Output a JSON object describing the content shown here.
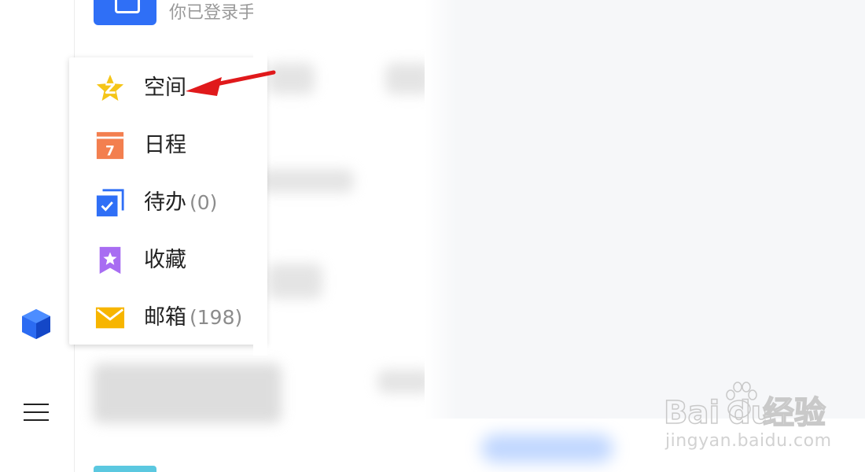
{
  "header": {
    "login_text": "你已登录手"
  },
  "menu": {
    "items": [
      {
        "label": "空间",
        "count": "",
        "icon": "qzone-star-icon",
        "color": "#f5c518"
      },
      {
        "label": "日程",
        "count": "",
        "icon": "calendar-icon",
        "color": "#f37f4f"
      },
      {
        "label": "待办",
        "count": "(0)",
        "icon": "todo-check-icon",
        "color": "#2f6ff6"
      },
      {
        "label": "收藏",
        "count": "",
        "icon": "bookmark-star-icon",
        "color": "#a86df2"
      },
      {
        "label": "邮箱",
        "count": "(198)",
        "icon": "mail-icon",
        "color": "#f7b500"
      }
    ],
    "calendar_day": "7"
  },
  "watermark": {
    "brand_left": "Bai",
    "brand_right": "du",
    "brand_cn": "经验",
    "url": "jingyan.baidu.com"
  }
}
